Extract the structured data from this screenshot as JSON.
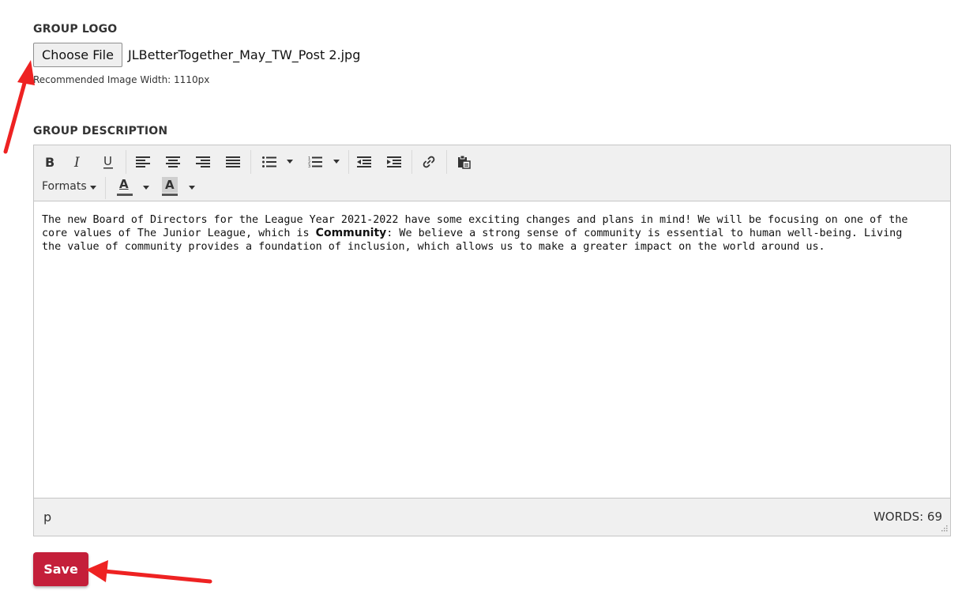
{
  "group_logo": {
    "label": "GROUP LOGO",
    "choose_file_label": "Choose File",
    "file_name": "JLBetterTogether_May_TW_Post 2.jpg",
    "hint": "Recommended Image Width: 1110px"
  },
  "group_description": {
    "label": "GROUP DESCRIPTION",
    "toolbar": {
      "buttons": [
        "bold-icon",
        "italic-icon",
        "underline-icon",
        "align-left-icon",
        "align-center-icon",
        "align-right-icon",
        "align-justify-icon",
        "bullet-list-icon",
        "numbered-list-icon",
        "outdent-icon",
        "indent-icon",
        "link-icon",
        "paste-icon"
      ],
      "formats_label": "Formats",
      "text_color_letter": "A",
      "background_color_letter": "A"
    },
    "content": {
      "text_before": "The new Board of Directors for the League Year 2021-2022 have some exciting changes and plans in mind! We will be focusing on one of the core values of The Junior League, which is ",
      "bold_word": "Community",
      "text_after": ": We believe a strong sense of community is essential to human well-being. Living the value of community provides a foundation of inclusion, which allows us to make a greater impact on the world around us."
    },
    "status": {
      "path": "p",
      "word_count": "WORDS: 69"
    }
  },
  "save_label": "Save",
  "colors": {
    "save_button": "#c41f3a",
    "annotation_arrow": "#ee2222",
    "toolbar_bg": "#f0f0f0"
  }
}
